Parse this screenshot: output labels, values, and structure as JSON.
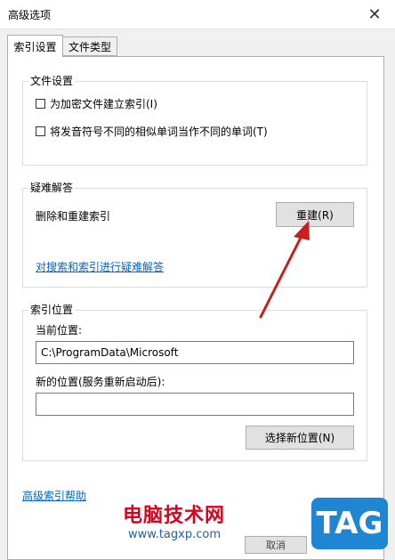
{
  "window": {
    "title": "高级选项",
    "close_glyph": "✕"
  },
  "tabs": [
    {
      "label": "索引设置",
      "active": true
    },
    {
      "label": "文件类型",
      "active": false
    }
  ],
  "file_settings": {
    "title": "文件设置",
    "options": [
      {
        "label": "为加密文件建立索引(I)",
        "checked": false
      },
      {
        "label": "将发音符号不同的相似单词当作不同的单词(T)",
        "checked": false
      }
    ]
  },
  "troubleshoot": {
    "title": "疑难解答",
    "rebuild_desc": "删除和重建索引",
    "rebuild_button": "重建(R)",
    "link": "对搜索和索引进行疑难解答"
  },
  "index_location": {
    "title": "索引位置",
    "current_label": "当前位置:",
    "current_value": "C:\\ProgramData\\Microsoft",
    "new_label": "新的位置(服务重新启动后):",
    "new_value": "",
    "select_button": "选择新位置(N)"
  },
  "help_link": "高级索引帮助",
  "footer": {
    "cancel_button": "取消"
  },
  "watermark": {
    "site_name": "电脑技术网",
    "url": "www.tagxp.com",
    "tag": "TAG"
  },
  "colors": {
    "link": "#0066cc",
    "arrow": "#c81e1e",
    "panel": "#ffffff",
    "window": "#f0f0f0"
  }
}
